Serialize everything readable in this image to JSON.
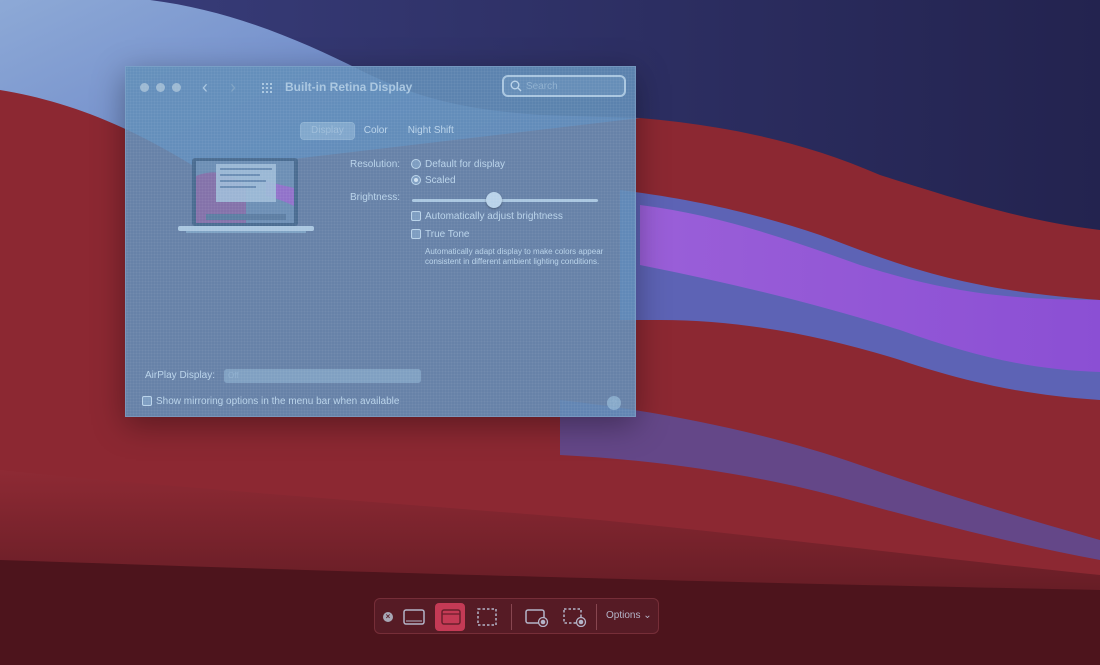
{
  "window": {
    "title": "Built-in Retina Display",
    "search_placeholder": "Search",
    "tabs": [
      {
        "label": "Display",
        "active": true
      },
      {
        "label": "Color",
        "active": false
      },
      {
        "label": "Night Shift",
        "active": false
      }
    ],
    "resolution": {
      "label": "Resolution:",
      "options": [
        {
          "label": "Default for display",
          "selected": false
        },
        {
          "label": "Scaled",
          "selected": true
        }
      ]
    },
    "brightness": {
      "label": "Brightness:",
      "level": 0.44,
      "auto_label": "Automatically adjust brightness",
      "auto_checked": false
    },
    "true_tone": {
      "label": "True Tone",
      "checked": false,
      "description": "Automatically adapt display to make colors appear consistent in different ambient lighting conditions."
    },
    "airplay": {
      "label": "AirPlay Display:",
      "value": "Off"
    },
    "mirroring_label": "Show mirroring options in the menu bar when available",
    "mirroring_checked": false,
    "help": "?"
  },
  "toolbar": {
    "close_glyph": "×",
    "options_label": "Options",
    "selected_tool": "capture-selected-window"
  },
  "colors": {
    "window_tint": "#628eb8",
    "toolbar_selected": "#c43a55",
    "wallpaper_red": "#8e2a34",
    "wallpaper_purple": "#8c55d6",
    "wallpaper_navy": "#26255a"
  }
}
